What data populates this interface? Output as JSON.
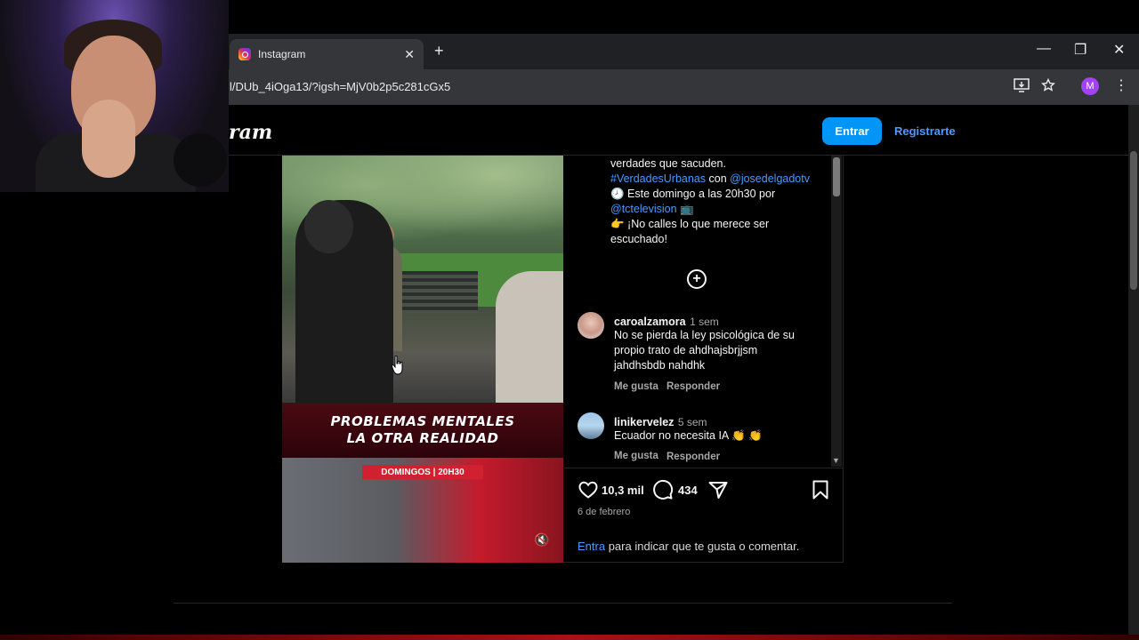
{
  "browser": {
    "tab_title": "Instagram",
    "tab_close": "✕",
    "new_tab": "+",
    "url": "l/DUb_4iOga13/?igsh=MjV0b2p5c281cGx5",
    "profile_initial": "M",
    "window_controls": {
      "minimize": "—",
      "restore": "❐",
      "close": "✕"
    },
    "icons": [
      "install-app-icon",
      "star-icon",
      "kebab-menu-icon"
    ]
  },
  "header": {
    "logo": "ram",
    "login_button": "Entrar",
    "register_link": "Registrarte"
  },
  "video": {
    "banner_line1": "PROBLEMAS MENTALES",
    "banner_line2": "LA OTRA REALIDAD",
    "schedule_pill": "DOMINGOS | 20H30",
    "mute_icon": "🔇"
  },
  "caption": {
    "line1": "verdades que sacuden.",
    "hashtag": "#VerdadesUrbanas",
    "con": " con ",
    "mention1": "@josedelgadotv",
    "line3": "🕗 Este domingo a las 20h30 por",
    "mention2": "@tctelevision",
    "tv_emoji": " 📺",
    "line5": "👉 ¡No calles lo que merece ser",
    "line6": "escuchado!"
  },
  "load_more_icon": "plus-circle-icon",
  "comments": [
    {
      "user": "caroalzamora",
      "time": "1 sem",
      "lines": [
        "No se pierda la ley psicológica de su",
        "propio trato de ahdhajsbrjjsm",
        "jahdhsbdb nahdhk"
      ],
      "like": "Me gusta",
      "reply": "Responder"
    },
    {
      "user": "linikervelez",
      "time": "5 sem",
      "lines": [
        "Ecuador no necesita IA 👏 👏"
      ],
      "like": "Me gusta",
      "reply": "Responder"
    }
  ],
  "actions": {
    "likes": "10,3 mil",
    "comments": "434",
    "date": "6 de febrero",
    "login_link": "Entra",
    "login_text": " para indicar que te gusta o comentar."
  },
  "colors": {
    "accent": "#0095f6",
    "link": "#4a9bff",
    "background": "#000000"
  }
}
